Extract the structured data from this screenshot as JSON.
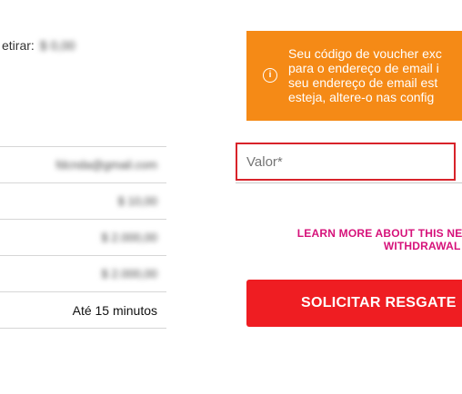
{
  "left_panel": {
    "retirar_label": "etirar:",
    "retirar_value": "$ 0,00",
    "rows": [
      {
        "value": "fdcnda@gmail.com",
        "masked": true
      },
      {
        "value": "$ 10,00",
        "masked": true
      },
      {
        "value": "$ 2.000,00",
        "masked": true
      },
      {
        "value": "$ 2.000,00",
        "masked": true
      },
      {
        "value": "Até 15 minutos",
        "masked": false
      }
    ]
  },
  "notice": {
    "icon": "info-icon",
    "lines": [
      "Seu código de voucher exc",
      "para o endereço de email i",
      "seu endereço de email est",
      "esteja, altere-o nas config"
    ],
    "color": "#f58a16"
  },
  "form": {
    "valor_placeholder": "Valor*",
    "highlight_color": "#d8232a"
  },
  "learn_more": {
    "line1": "LEARN MORE ABOUT THIS NEW",
    "line2": "WITHDRAWAL M",
    "color": "#d6127a"
  },
  "submit": {
    "label": "SOLICITAR RESGATE",
    "color": "#ef1d22"
  }
}
